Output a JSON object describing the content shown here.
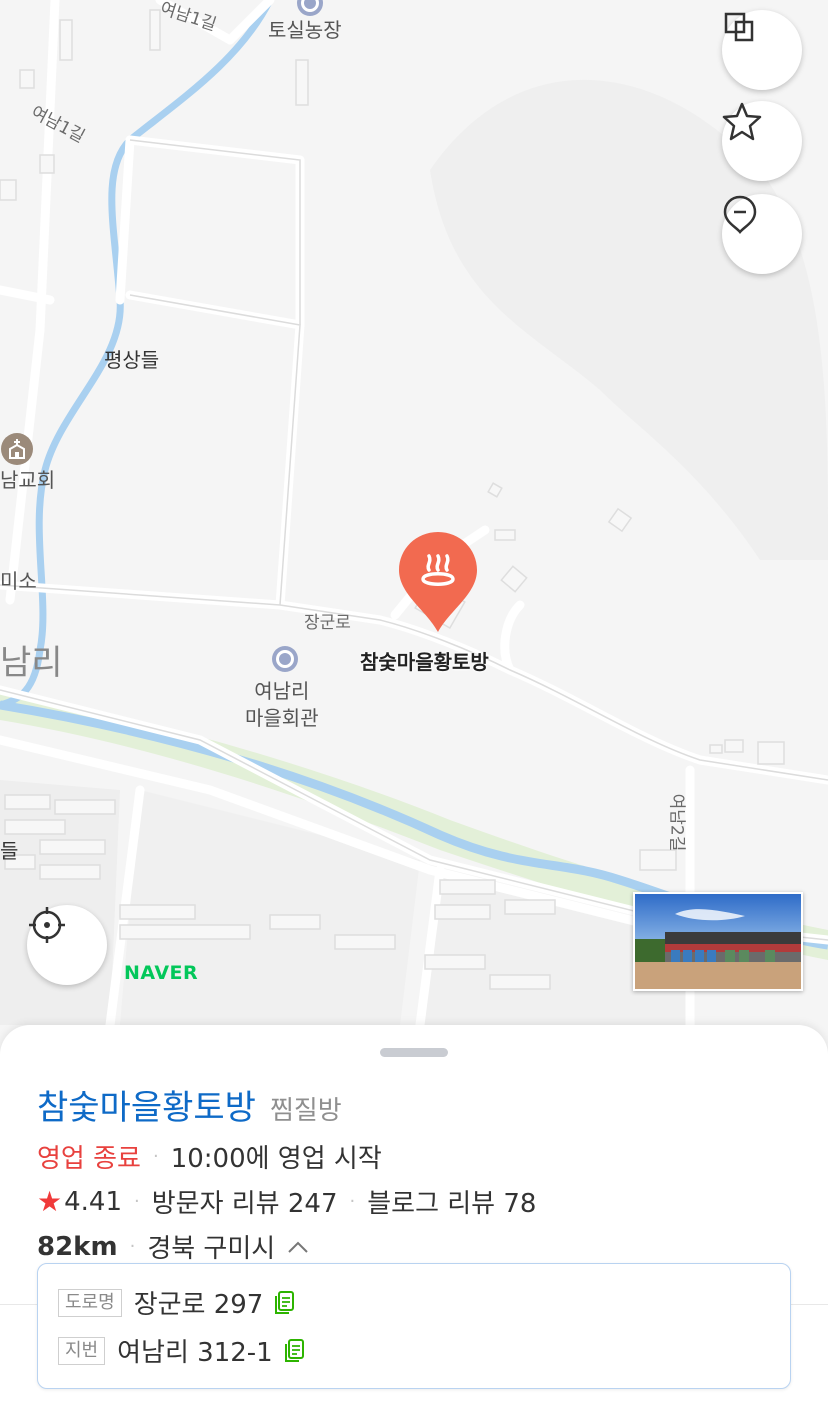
{
  "map": {
    "road_labels": [
      "여남1길",
      "여남1길",
      "장군로",
      "여남2길"
    ],
    "area_labels": [
      "평상들",
      "남리",
      "들"
    ],
    "poi_labels": {
      "farm": "토실농장",
      "church": "남교회",
      "misc": "미소",
      "hall_line1": "여남리",
      "hall_line2": "마을회관"
    },
    "place_name": "참숯마을황토방",
    "brand": "NAVER",
    "marker_color": "#f26a50",
    "stream_color": "#a9d0f0"
  },
  "controls": {
    "layers_icon": "layers-icon",
    "star_icon": "star-icon",
    "pin_icon": "location-pin-icon",
    "locate_icon": "current-location-icon"
  },
  "place": {
    "name": "참숯마을황토방",
    "category": "찜질방",
    "status": "영업 종료",
    "hours": "10:00에 영업 시작",
    "rating": "4.41",
    "visitor_reviews": "방문자 리뷰 247",
    "blog_reviews": "블로그 리뷰 78",
    "distance": "82km",
    "region": "경북 구미시",
    "road_tag": "도로명",
    "road_address": "장군로 297",
    "lot_tag": "지번",
    "lot_address": "여남리 312-1",
    "name_color": "#0e6ac7",
    "closed_color": "#e8413e",
    "star_color": "#f03a3a"
  }
}
